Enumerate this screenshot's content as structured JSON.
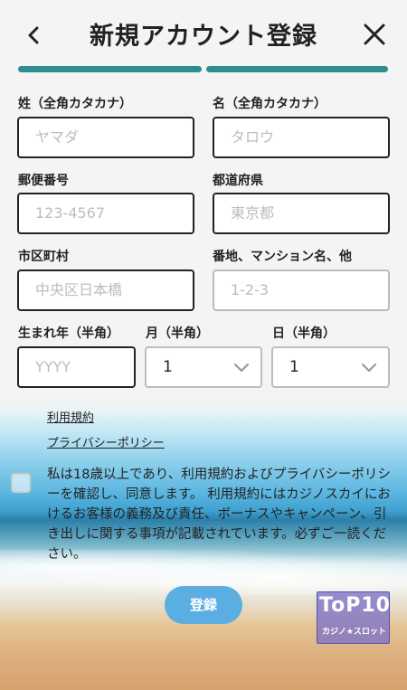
{
  "header": {
    "back_icon": "chevron-left-icon",
    "title": "新規アカウント登録",
    "close_icon": "close-icon"
  },
  "progress": {
    "steps": 2,
    "current": 2,
    "color": "#2f8c8e"
  },
  "form": {
    "last_name": {
      "label": "姓（全角カタカナ）",
      "placeholder": "ヤマダ"
    },
    "first_name": {
      "label": "名（全角カタカナ）",
      "placeholder": "タロウ"
    },
    "postal_code": {
      "label": "郵便番号",
      "placeholder": "123-4567"
    },
    "prefecture": {
      "label": "都道府県",
      "placeholder": "東京都"
    },
    "city": {
      "label": "市区町村",
      "placeholder": "中央区日本橋"
    },
    "address": {
      "label": "番地、マンション名、他",
      "placeholder": "1-2-3"
    },
    "birth_year": {
      "label": "生まれ年（半角）",
      "placeholder": "YYYY"
    },
    "birth_month": {
      "label": "月（半角）",
      "value": "1"
    },
    "birth_day": {
      "label": "日（半角）",
      "value": "1"
    }
  },
  "links": {
    "terms": "利用規約",
    "privacy": "プライバシーポリシー"
  },
  "agreement": {
    "checked": false,
    "text": "私は18歳以上であり、利用規約およびプライバシーポリシーを確認し、同意します。 利用規約にはカジノスカイにおけるお客様の義務及び責任、ボーナスやキャンペーン、引き出しに関する事項が記載されています。必ずご一読ください。"
  },
  "submit_label": "登録",
  "watermark": {
    "top": "ToP10",
    "bottom": "カジノ★スロット"
  },
  "colors": {
    "accent": "#2f8c8e",
    "button": "#5aaee2"
  }
}
